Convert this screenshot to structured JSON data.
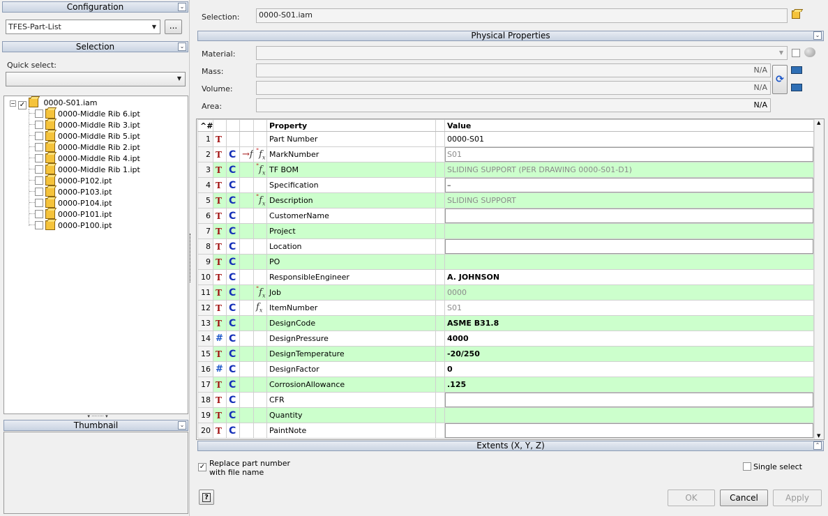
{
  "left": {
    "config_header": "Configuration",
    "config_value": "TFES-Part-List",
    "config_more": "...",
    "selection_header": "Selection",
    "quick_select_label": "Quick select:",
    "quick_select_value": "",
    "tree_root": "0000-S01.iam",
    "tree_items": [
      "0000-Middle Rib 6.ipt",
      "0000-Middle Rib 3.ipt",
      "0000-Middle Rib 5.ipt",
      "0000-Middle Rib 2.ipt",
      "0000-Middle Rib 4.ipt",
      "0000-Middle Rib 1.ipt",
      "0000-P102.ipt",
      "0000-P103.ipt",
      "0000-P104.ipt",
      "0000-P101.ipt",
      "0000-P100.ipt"
    ],
    "thumbnail_header": "Thumbnail"
  },
  "right": {
    "selection_label": "Selection:",
    "selection_value": "0000-S01.iam",
    "physical_header": "Physical Properties",
    "material_label": "Material:",
    "mass_label": "Mass:",
    "mass_value": "N/A",
    "volume_label": "Volume:",
    "volume_value": "N/A",
    "area_label": "Area:",
    "area_value": "N/A",
    "extents_header": "Extents (X, Y, Z)",
    "replace_label": "Replace part number with file name",
    "single_select_label": "Single select",
    "ok": "OK",
    "cancel": "Cancel",
    "apply": "Apply",
    "help": "?"
  },
  "grid": {
    "sort_header": "^#",
    "property_header": "Property",
    "value_header": "Value",
    "rows": [
      {
        "n": "1",
        "type": "T",
        "c": false,
        "fx1": false,
        "fx2": false,
        "prop": "Part Number",
        "val": "0000-S01",
        "style": "plain",
        "bg": "w"
      },
      {
        "n": "2",
        "type": "T",
        "c": true,
        "fx1": true,
        "fx2": "red",
        "prop": "MarkNumber",
        "val": "S01",
        "style": "grayedit",
        "bg": "w"
      },
      {
        "n": "3",
        "type": "T",
        "c": true,
        "fx1": false,
        "fx2": "red",
        "prop": "TF BOM",
        "val": "SLIDING SUPPORT (PER DRAWING 0000-S01-D1)",
        "style": "gray",
        "bg": "g"
      },
      {
        "n": "4",
        "type": "T",
        "c": true,
        "fx1": false,
        "fx2": false,
        "prop": "Specification",
        "val": "–",
        "style": "edit",
        "bg": "w"
      },
      {
        "n": "5",
        "type": "T",
        "c": true,
        "fx1": false,
        "fx2": "red",
        "prop": "Description",
        "val": "SLIDING SUPPORT",
        "style": "gray",
        "bg": "g"
      },
      {
        "n": "6",
        "type": "T",
        "c": true,
        "fx1": false,
        "fx2": false,
        "prop": "CustomerName",
        "val": "",
        "style": "edit",
        "bg": "w"
      },
      {
        "n": "7",
        "type": "T",
        "c": true,
        "fx1": false,
        "fx2": false,
        "prop": "Project",
        "val": "",
        "style": "plain",
        "bg": "g"
      },
      {
        "n": "8",
        "type": "T",
        "c": true,
        "fx1": false,
        "fx2": false,
        "prop": "Location",
        "val": "",
        "style": "edit",
        "bg": "w"
      },
      {
        "n": "9",
        "type": "T",
        "c": true,
        "fx1": false,
        "fx2": false,
        "prop": "PO",
        "val": "",
        "style": "plain",
        "bg": "g"
      },
      {
        "n": "10",
        "type": "T",
        "c": true,
        "fx1": false,
        "fx2": false,
        "prop": "ResponsibleEngineer",
        "val": "A. JOHNSON",
        "style": "bold",
        "bg": "w"
      },
      {
        "n": "11",
        "type": "T",
        "c": true,
        "fx1": false,
        "fx2": "red",
        "prop": "Job",
        "val": "0000",
        "style": "gray",
        "bg": "g"
      },
      {
        "n": "12",
        "type": "T",
        "c": true,
        "fx1": false,
        "fx2": "plain",
        "prop": "ItemNumber",
        "val": "S01",
        "style": "gray",
        "bg": "w"
      },
      {
        "n": "13",
        "type": "T",
        "c": true,
        "fx1": false,
        "fx2": false,
        "prop": "DesignCode",
        "val": "ASME B31.8",
        "style": "bold",
        "bg": "g"
      },
      {
        "n": "14",
        "type": "#",
        "c": true,
        "fx1": false,
        "fx2": false,
        "prop": "DesignPressure",
        "val": "4000",
        "style": "bold",
        "bg": "w"
      },
      {
        "n": "15",
        "type": "T",
        "c": true,
        "fx1": false,
        "fx2": false,
        "prop": "DesignTemperature",
        "val": "-20/250",
        "style": "bold",
        "bg": "g"
      },
      {
        "n": "16",
        "type": "#",
        "c": true,
        "fx1": false,
        "fx2": false,
        "prop": "DesignFactor",
        "val": "0",
        "style": "bold",
        "bg": "w"
      },
      {
        "n": "17",
        "type": "T",
        "c": true,
        "fx1": false,
        "fx2": false,
        "prop": "CorrosionAllowance",
        "val": ".125",
        "style": "bold",
        "bg": "g"
      },
      {
        "n": "18",
        "type": "T",
        "c": true,
        "fx1": false,
        "fx2": false,
        "prop": "CFR",
        "val": "",
        "style": "edit",
        "bg": "w"
      },
      {
        "n": "19",
        "type": "T",
        "c": true,
        "fx1": false,
        "fx2": false,
        "prop": "Quantity",
        "val": "",
        "style": "plain",
        "bg": "g"
      },
      {
        "n": "20",
        "type": "T",
        "c": true,
        "fx1": false,
        "fx2": false,
        "prop": "PaintNote",
        "val": "",
        "style": "edit",
        "bg": "w"
      }
    ]
  },
  "colors": {
    "row_green": "#ccffcc",
    "header_gradient": "#c9d3e2",
    "text_red": "#a01010",
    "c_blue": "#1530b8"
  }
}
